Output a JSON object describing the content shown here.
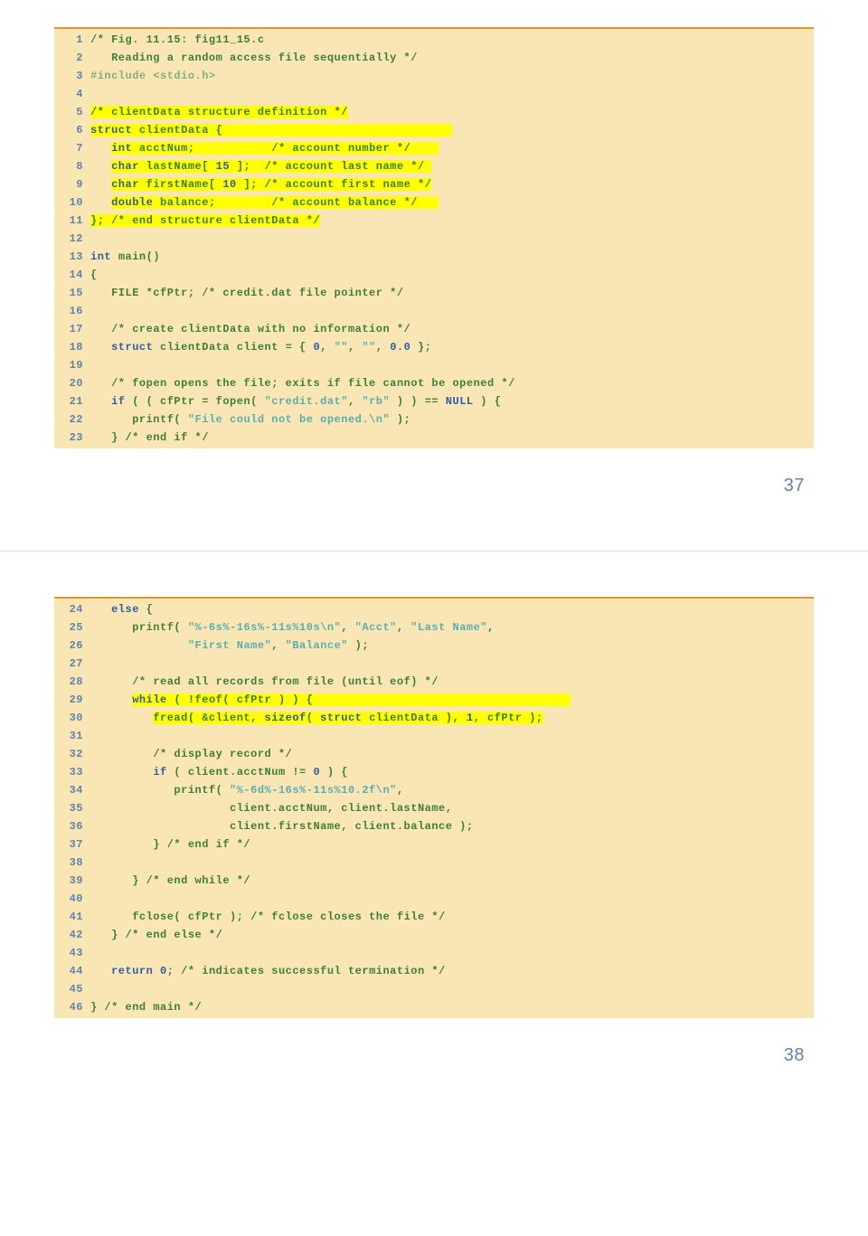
{
  "slide1": {
    "page_number": "37",
    "lines": [
      {
        "num": "1",
        "segs": [
          {
            "t": "/* Fig. 11.15: fig11_15.c",
            "cls": "c-comment"
          }
        ]
      },
      {
        "num": "2",
        "segs": [
          {
            "t": "   Reading a random access file sequentially */",
            "cls": "c-comment"
          }
        ]
      },
      {
        "num": "3",
        "segs": [
          {
            "t": "#include ",
            "cls": "c-pre"
          },
          {
            "t": "<stdio.h>",
            "cls": "c-pre"
          }
        ]
      },
      {
        "num": "4",
        "segs": []
      },
      {
        "num": "5",
        "segs": [
          {
            "t": "/* clientData structure definition */",
            "cls": "c-comment",
            "hl": true
          }
        ]
      },
      {
        "num": "6",
        "segs": [
          {
            "t": "struct ",
            "cls": "c-kw",
            "hl": true
          },
          {
            "t": "clientData {                                 ",
            "cls": "c-text",
            "hl": true
          }
        ]
      },
      {
        "num": "7",
        "segs": [
          {
            "t": "   ",
            "cls": ""
          },
          {
            "t": "int ",
            "cls": "c-kw",
            "hl": true
          },
          {
            "t": "acctNum;           ",
            "cls": "c-text",
            "hl": true
          },
          {
            "t": "/* account number */    ",
            "cls": "c-comment",
            "hl": true
          }
        ]
      },
      {
        "num": "8",
        "segs": [
          {
            "t": "   ",
            "cls": ""
          },
          {
            "t": "char ",
            "cls": "c-kw",
            "hl": true
          },
          {
            "t": "lastName[ ",
            "cls": "c-text",
            "hl": true
          },
          {
            "t": "15",
            "cls": "c-num",
            "hl": true
          },
          {
            "t": " ];  ",
            "cls": "c-text",
            "hl": true
          },
          {
            "t": "/* account last name */ ",
            "cls": "c-comment",
            "hl": true
          }
        ]
      },
      {
        "num": "9",
        "segs": [
          {
            "t": "   ",
            "cls": ""
          },
          {
            "t": "char ",
            "cls": "c-kw",
            "hl": true
          },
          {
            "t": "firstName[ ",
            "cls": "c-text",
            "hl": true
          },
          {
            "t": "10",
            "cls": "c-num",
            "hl": true
          },
          {
            "t": " ]; ",
            "cls": "c-text",
            "hl": true
          },
          {
            "t": "/* account first name */",
            "cls": "c-comment",
            "hl": true
          }
        ]
      },
      {
        "num": "10",
        "segs": [
          {
            "t": "   ",
            "cls": ""
          },
          {
            "t": "double ",
            "cls": "c-kw",
            "hl": true
          },
          {
            "t": "balance;        ",
            "cls": "c-text",
            "hl": true
          },
          {
            "t": "/* account balance */   ",
            "cls": "c-comment",
            "hl": true
          }
        ]
      },
      {
        "num": "11",
        "segs": [
          {
            "t": "}; ",
            "cls": "c-text",
            "hl": true
          },
          {
            "t": "/* end structure clientData */",
            "cls": "c-comment",
            "hl": true
          }
        ]
      },
      {
        "num": "12",
        "segs": []
      },
      {
        "num": "13",
        "segs": [
          {
            "t": "int ",
            "cls": "c-kw"
          },
          {
            "t": "main()",
            "cls": "c-text"
          }
        ]
      },
      {
        "num": "14",
        "segs": [
          {
            "t": "{",
            "cls": "c-text"
          }
        ]
      },
      {
        "num": "15",
        "segs": [
          {
            "t": "   FILE *cfPtr; ",
            "cls": "c-text"
          },
          {
            "t": "/* credit.dat file pointer */",
            "cls": "c-comment"
          }
        ]
      },
      {
        "num": "16",
        "segs": []
      },
      {
        "num": "17",
        "segs": [
          {
            "t": "   ",
            "cls": ""
          },
          {
            "t": "/* create clientData with no information */",
            "cls": "c-comment"
          }
        ]
      },
      {
        "num": "18",
        "segs": [
          {
            "t": "   ",
            "cls": ""
          },
          {
            "t": "struct ",
            "cls": "c-kw"
          },
          {
            "t": "clientData client = { ",
            "cls": "c-text"
          },
          {
            "t": "0",
            "cls": "c-num"
          },
          {
            "t": ", ",
            "cls": "c-text"
          },
          {
            "t": "\"\"",
            "cls": "c-str"
          },
          {
            "t": ", ",
            "cls": "c-text"
          },
          {
            "t": "\"\"",
            "cls": "c-str"
          },
          {
            "t": ", ",
            "cls": "c-text"
          },
          {
            "t": "0.0",
            "cls": "c-num"
          },
          {
            "t": " };",
            "cls": "c-text"
          }
        ]
      },
      {
        "num": "19",
        "segs": []
      },
      {
        "num": "20",
        "segs": [
          {
            "t": "   ",
            "cls": ""
          },
          {
            "t": "/* fopen opens the file; exits if file cannot be opened */",
            "cls": "c-comment"
          }
        ]
      },
      {
        "num": "21",
        "segs": [
          {
            "t": "   ",
            "cls": ""
          },
          {
            "t": "if ",
            "cls": "c-kw"
          },
          {
            "t": "( ( cfPtr = fopen( ",
            "cls": "c-text"
          },
          {
            "t": "\"credit.dat\"",
            "cls": "c-str"
          },
          {
            "t": ", ",
            "cls": "c-text"
          },
          {
            "t": "\"rb\"",
            "cls": "c-str"
          },
          {
            "t": " ) ) == ",
            "cls": "c-text"
          },
          {
            "t": "NULL",
            "cls": "c-null"
          },
          {
            "t": " ) {",
            "cls": "c-text"
          }
        ]
      },
      {
        "num": "22",
        "segs": [
          {
            "t": "      printf( ",
            "cls": "c-text"
          },
          {
            "t": "\"File could not be opened.\\n\"",
            "cls": "c-str"
          },
          {
            "t": " );",
            "cls": "c-text"
          }
        ]
      },
      {
        "num": "23",
        "segs": [
          {
            "t": "   } ",
            "cls": "c-text"
          },
          {
            "t": "/* end if */",
            "cls": "c-comment"
          }
        ]
      }
    ]
  },
  "slide2": {
    "page_number": "38",
    "lines": [
      {
        "num": "24",
        "segs": [
          {
            "t": "   ",
            "cls": ""
          },
          {
            "t": "else ",
            "cls": "c-kw"
          },
          {
            "t": "{",
            "cls": "c-text"
          }
        ]
      },
      {
        "num": "25",
        "segs": [
          {
            "t": "      printf( ",
            "cls": "c-text"
          },
          {
            "t": "\"%-6s%-16s%-11s%10s\\n\"",
            "cls": "c-str"
          },
          {
            "t": ", ",
            "cls": "c-text"
          },
          {
            "t": "\"Acct\"",
            "cls": "c-str"
          },
          {
            "t": ", ",
            "cls": "c-text"
          },
          {
            "t": "\"Last Name\"",
            "cls": "c-str"
          },
          {
            "t": ",",
            "cls": "c-text"
          }
        ]
      },
      {
        "num": "26",
        "segs": [
          {
            "t": "              ",
            "cls": ""
          },
          {
            "t": "\"First Name\"",
            "cls": "c-str"
          },
          {
            "t": ", ",
            "cls": "c-text"
          },
          {
            "t": "\"Balance\"",
            "cls": "c-str"
          },
          {
            "t": " );",
            "cls": "c-text"
          }
        ]
      },
      {
        "num": "27",
        "segs": []
      },
      {
        "num": "28",
        "segs": [
          {
            "t": "      ",
            "cls": ""
          },
          {
            "t": "/* read all records from file (until eof) */",
            "cls": "c-comment"
          }
        ]
      },
      {
        "num": "29",
        "segs": [
          {
            "t": "      ",
            "cls": ""
          },
          {
            "t": "while ",
            "cls": "c-kw",
            "hl": true
          },
          {
            "t": "( !feof( cfPtr ) ) {                                     ",
            "cls": "c-text",
            "hl": true
          }
        ]
      },
      {
        "num": "30",
        "segs": [
          {
            "t": "         ",
            "cls": ""
          },
          {
            "t": "fread( &client, ",
            "cls": "c-text",
            "hl": true
          },
          {
            "t": "sizeof",
            "cls": "c-kw",
            "hl": true
          },
          {
            "t": "( ",
            "cls": "c-text",
            "hl": true
          },
          {
            "t": "struct ",
            "cls": "c-kw",
            "hl": true
          },
          {
            "t": "clientData ), ",
            "cls": "c-text",
            "hl": true
          },
          {
            "t": "1",
            "cls": "c-num",
            "hl": true
          },
          {
            "t": ", cfPtr );",
            "cls": "c-text",
            "hl": true
          }
        ]
      },
      {
        "num": "31",
        "segs": []
      },
      {
        "num": "32",
        "segs": [
          {
            "t": "         ",
            "cls": ""
          },
          {
            "t": "/* display record */",
            "cls": "c-comment"
          }
        ]
      },
      {
        "num": "33",
        "segs": [
          {
            "t": "         ",
            "cls": ""
          },
          {
            "t": "if ",
            "cls": "c-kw"
          },
          {
            "t": "( client.acctNum != ",
            "cls": "c-text"
          },
          {
            "t": "0",
            "cls": "c-num"
          },
          {
            "t": " ) {",
            "cls": "c-text"
          }
        ]
      },
      {
        "num": "34",
        "segs": [
          {
            "t": "            printf( ",
            "cls": "c-text"
          },
          {
            "t": "\"%-6d%-16s%-11s%10.2f\\n\"",
            "cls": "c-str"
          },
          {
            "t": ",",
            "cls": "c-text"
          }
        ]
      },
      {
        "num": "35",
        "segs": [
          {
            "t": "                    client.acctNum, client.lastName,",
            "cls": "c-text"
          }
        ]
      },
      {
        "num": "36",
        "segs": [
          {
            "t": "                    client.firstName, client.balance );",
            "cls": "c-text"
          }
        ]
      },
      {
        "num": "37",
        "segs": [
          {
            "t": "         } ",
            "cls": "c-text"
          },
          {
            "t": "/* end if */",
            "cls": "c-comment"
          }
        ]
      },
      {
        "num": "38",
        "segs": []
      },
      {
        "num": "39",
        "segs": [
          {
            "t": "      } ",
            "cls": "c-text"
          },
          {
            "t": "/* end while */",
            "cls": "c-comment"
          }
        ]
      },
      {
        "num": "40",
        "segs": []
      },
      {
        "num": "41",
        "segs": [
          {
            "t": "      fclose( cfPtr ); ",
            "cls": "c-text"
          },
          {
            "t": "/* fclose closes the file */",
            "cls": "c-comment"
          }
        ]
      },
      {
        "num": "42",
        "segs": [
          {
            "t": "   } ",
            "cls": "c-text"
          },
          {
            "t": "/* end else */",
            "cls": "c-comment"
          }
        ]
      },
      {
        "num": "43",
        "segs": []
      },
      {
        "num": "44",
        "segs": [
          {
            "t": "   ",
            "cls": ""
          },
          {
            "t": "return ",
            "cls": "c-kw"
          },
          {
            "t": "0",
            "cls": "c-num"
          },
          {
            "t": "; ",
            "cls": "c-text"
          },
          {
            "t": "/* indicates successful termination */",
            "cls": "c-comment"
          }
        ]
      },
      {
        "num": "45",
        "segs": []
      },
      {
        "num": "46",
        "segs": [
          {
            "t": "} ",
            "cls": "c-text"
          },
          {
            "t": "/* end main */",
            "cls": "c-comment"
          }
        ]
      }
    ]
  }
}
